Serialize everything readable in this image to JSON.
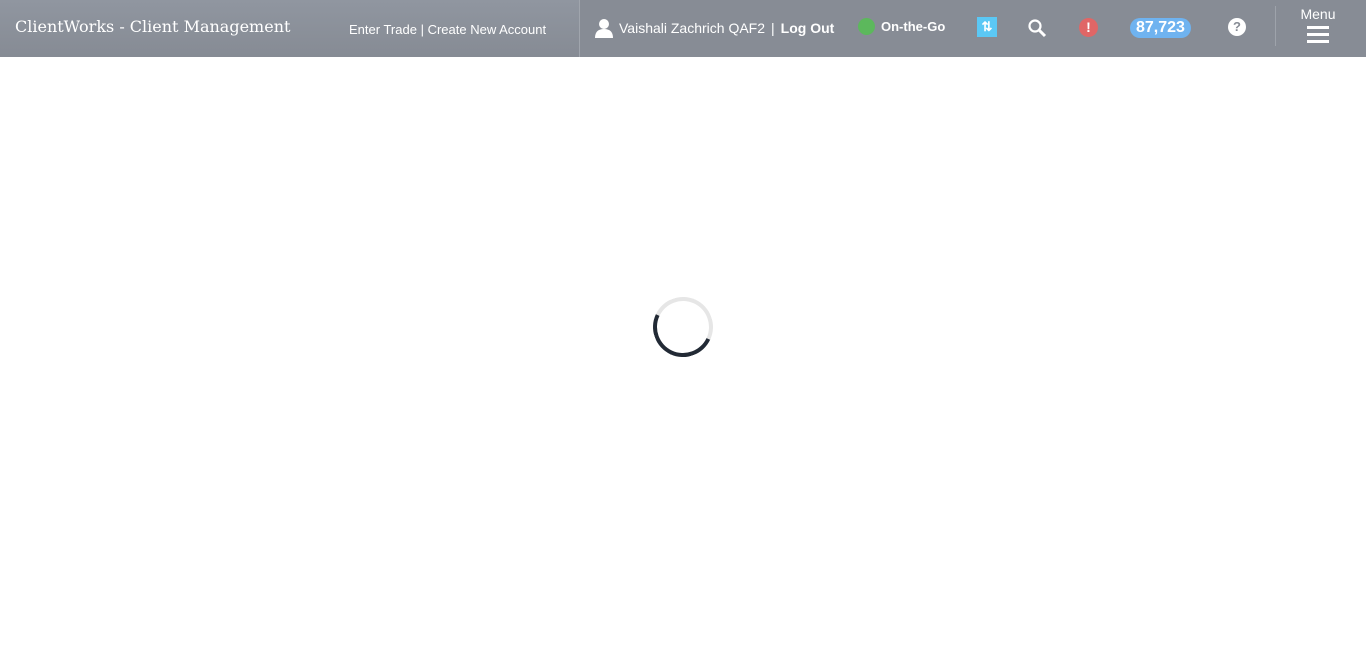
{
  "header": {
    "app_title": "ClientWorks - Client Management",
    "enter_trade": "Enter Trade",
    "link_separator": "|",
    "create_account": "Create New Account",
    "user_name": "Vaishali Zachrich QAF2",
    "user_separator": "|",
    "logout": "Log Out",
    "status": "On-the-Go",
    "status_color": "#5cb85c",
    "sync_glyph": "⇅",
    "alert_glyph": "!",
    "count": "87,723",
    "help_glyph": "?",
    "menu_label": "Menu"
  },
  "main": {
    "loading": true
  }
}
